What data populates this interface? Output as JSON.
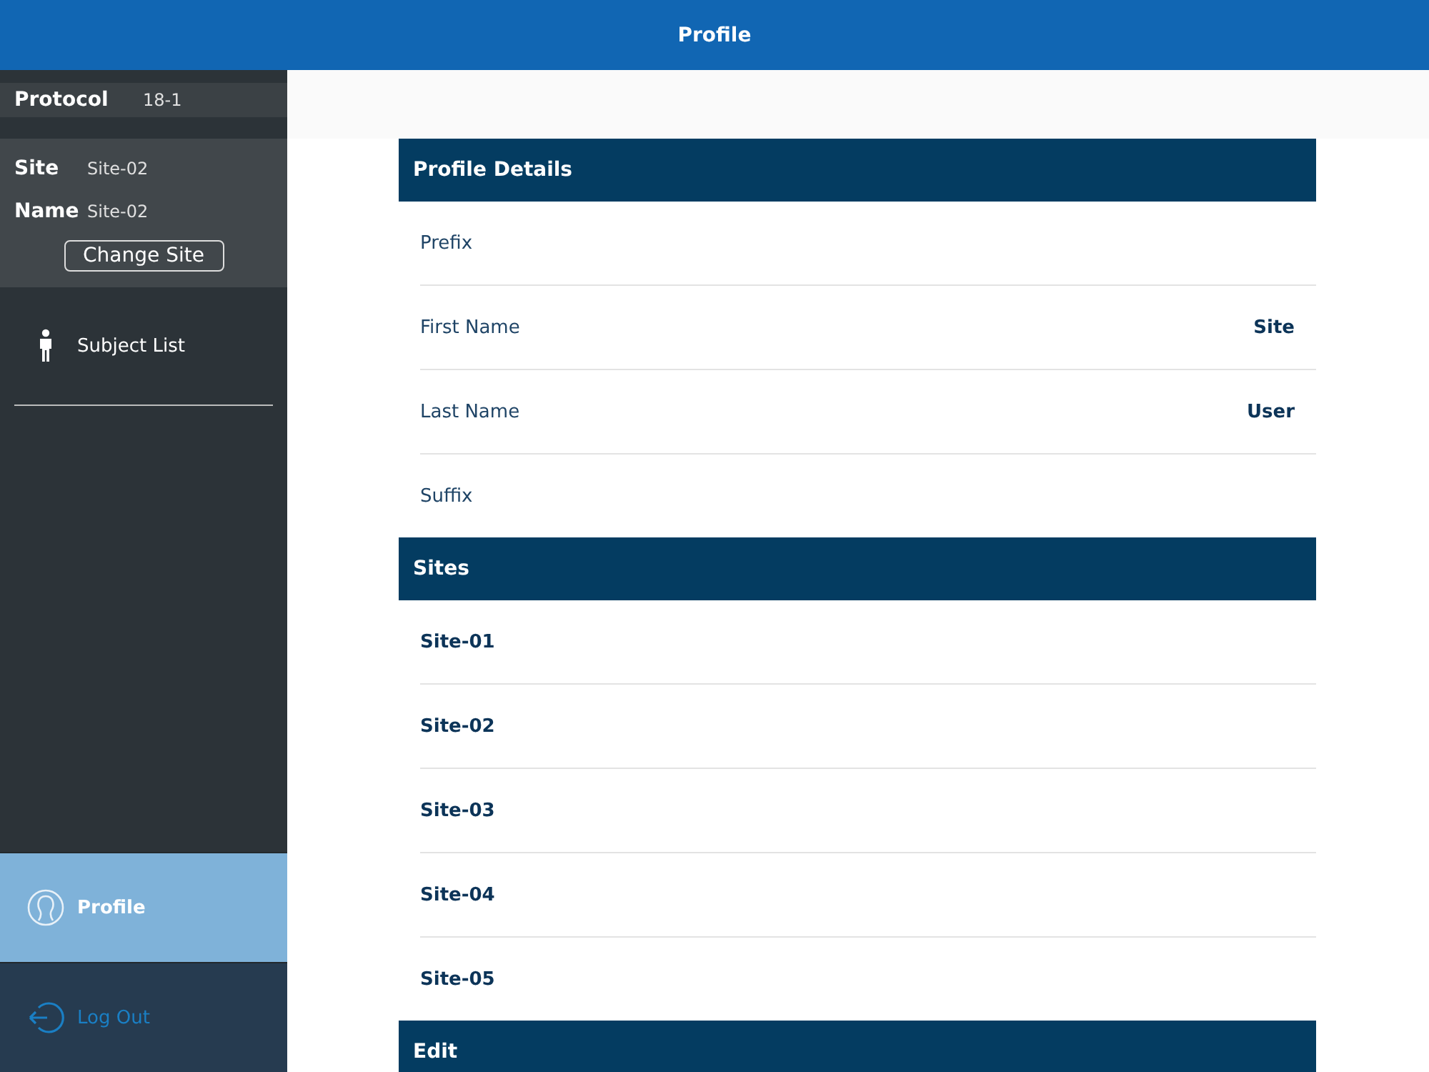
{
  "header": {
    "title": "Profile"
  },
  "sidebar": {
    "protocol": {
      "label": "Protocol",
      "value": "18-1"
    },
    "site_info": [
      {
        "label": "Site",
        "value": "Site-02"
      },
      {
        "label": "Name",
        "value": "Site-02"
      }
    ],
    "change_site_button": "Change Site",
    "menu": [
      {
        "kind": "person",
        "label": "Subject List",
        "selected": false
      }
    ],
    "bottom_menu": [
      {
        "kind": "profile",
        "label": "Profile",
        "selected": true
      },
      {
        "kind": "logout",
        "label": "Log Out",
        "selected": false
      }
    ]
  },
  "sections": [
    {
      "title": "Profile Details",
      "rows": [
        {
          "label": "Prefix"
        },
        {
          "label": "First Name",
          "value": "Site"
        },
        {
          "label": "Last Name",
          "value": "User"
        },
        {
          "label": "Suffix"
        }
      ]
    },
    {
      "title": "Sites",
      "rows": [
        {
          "label": "Site-01",
          "kind": "site"
        },
        {
          "label": "Site-02",
          "kind": "site"
        },
        {
          "label": "Site-03",
          "kind": "site"
        },
        {
          "label": "Site-04",
          "kind": "site"
        },
        {
          "label": "Site-05",
          "kind": "site"
        }
      ]
    },
    {
      "title": "Edit"
    }
  ]
}
